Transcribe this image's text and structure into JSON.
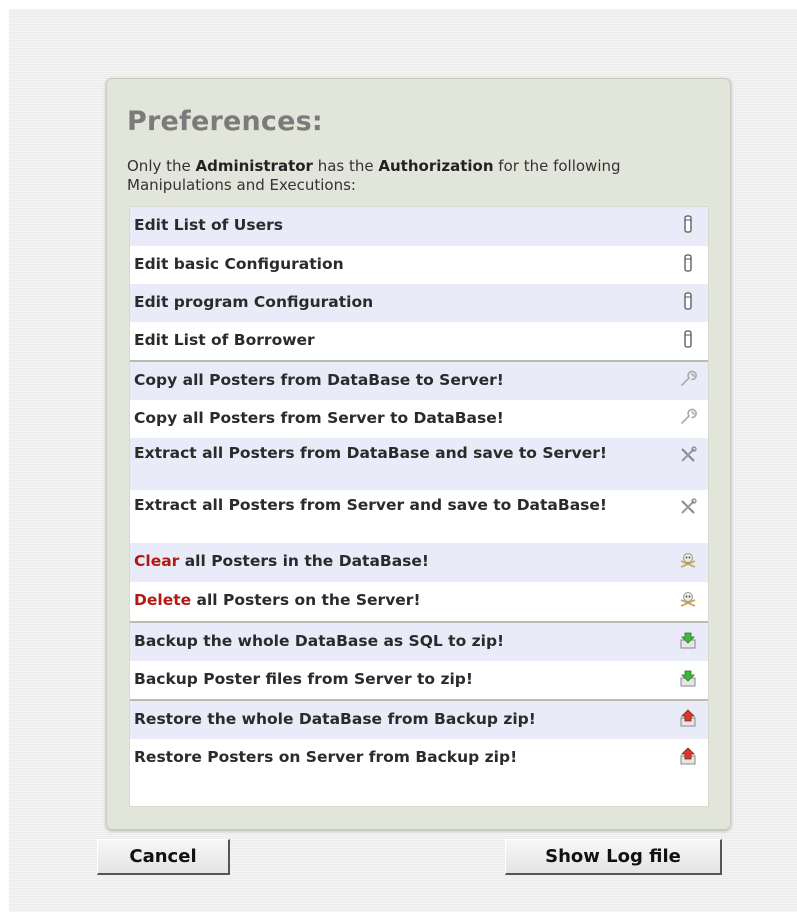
{
  "dialog": {
    "title": "Preferences:",
    "intro": {
      "t1": "Only the ",
      "b1": "Administrator",
      "t2": " has the ",
      "b2": "Authorization",
      "t3": " for the following Manipulations and Executions:"
    }
  },
  "items": [
    {
      "label": "Edit List of Users",
      "icon": "edit-lock-icon"
    },
    {
      "label": "Edit basic Configuration",
      "icon": "edit-lock-icon"
    },
    {
      "label": "Edit program Configuration",
      "icon": "edit-lock-icon"
    },
    {
      "label": "Edit List of Borrower",
      "icon": "edit-lock-icon"
    },
    {
      "label": "Copy all Posters from DataBase to Server!",
      "icon": "wrench-icon"
    },
    {
      "label": "Copy all Posters from Server to DataBase!",
      "icon": "wrench-icon"
    },
    {
      "label": "Extract all Posters from DataBase and save to Server!",
      "icon": "tools-icon"
    },
    {
      "label": "Extract all Posters from Server and save to DataBase!",
      "icon": "tools-icon"
    },
    {
      "prefix": "Clear",
      "label": " all Posters in the DataBase!",
      "icon": "skull-icon"
    },
    {
      "prefix": "Delete",
      "label": " all Posters on the Server!",
      "icon": "skull-icon"
    },
    {
      "label": "Backup the whole DataBase as SQL to zip!",
      "icon": "download-icon"
    },
    {
      "label": "Backup Poster files from Server to zip!",
      "icon": "download-icon"
    },
    {
      "label": "Restore the whole DataBase from Backup zip!",
      "icon": "upload-icon"
    },
    {
      "label": "Restore Posters on Server from Backup zip!",
      "icon": "upload-icon"
    }
  ],
  "buttons": {
    "cancel": "Cancel",
    "show_log": "Show Log file"
  },
  "colors": {
    "panel": "#e2e5d9",
    "row_alt": "#e9ecf8",
    "danger_text": "#b01a10",
    "title": "#7b7b7b"
  }
}
